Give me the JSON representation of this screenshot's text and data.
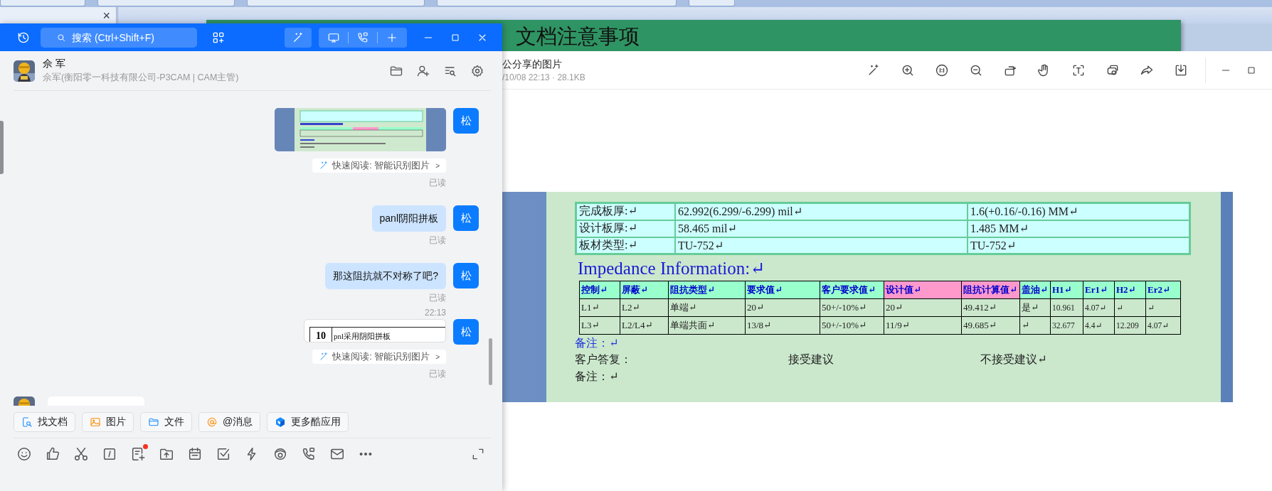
{
  "background": {
    "close_glyph": "×",
    "banner_title": "文档注意事项"
  },
  "chat": {
    "search": {
      "placeholder": "搜索 (Ctrl+Shift+F)"
    },
    "contact": {
      "name": "佘 军",
      "subtitle": "佘军(衡阳零一科技有限公司-P3CAM | CAM主管)"
    },
    "messages": [
      {
        "kind": "image",
        "avatar": "松",
        "quick_read": "快速阅读: 智能识别图片",
        "quick_read_chevron": ">",
        "status": "已读"
      },
      {
        "kind": "text",
        "avatar": "松",
        "text": "panl阴阳拼板",
        "status": "已读"
      },
      {
        "kind": "text",
        "avatar": "松",
        "text": "那这阻抗就不对称了吧?",
        "status": "已读"
      },
      {
        "kind": "time",
        "text": "22:13"
      },
      {
        "kind": "doc_image",
        "avatar": "松",
        "cells": [
          "10",
          "pnl采用阴阳拼板"
        ],
        "quick_read": "快速阅读: 智能识别图片",
        "quick_read_chevron": ">",
        "status": "已读"
      },
      {
        "kind": "incoming"
      }
    ],
    "quick_actions": [
      {
        "kind": "docs",
        "label": "找文档"
      },
      {
        "kind": "image",
        "label": "图片"
      },
      {
        "kind": "file",
        "label": "文件"
      },
      {
        "kind": "mention",
        "label": "@消息"
      },
      {
        "kind": "apps",
        "label": "更多酷应用"
      }
    ],
    "composer": {
      "note_badge": true
    }
  },
  "viewer": {
    "title": "公分享的图片",
    "meta": "/10/08 22:13 · 28.1KB",
    "document": {
      "info_rows": [
        [
          "完成板厚:↵",
          "62.992(6.299/-6.299) mil↵",
          "1.6(+0.16/-0.16) MM↵"
        ],
        [
          "设计板厚:↵",
          "58.465 mil↵",
          "1.485 MM↵"
        ],
        [
          "板材类型:↵",
          "TU-752↵",
          "TU-752↵"
        ]
      ],
      "impedance_title": "Impedance Information:↵",
      "columns": [
        {
          "label": "控制↵",
          "color": "#99ffcc"
        },
        {
          "label": "屏蔽↵",
          "color": "#99ffcc"
        },
        {
          "label": "阻抗类型↵",
          "color": "#99ffcc"
        },
        {
          "label": "要求值↵",
          "color": "#99ffcc"
        },
        {
          "label": "客户要求值↵",
          "color": "#99ffcc"
        },
        {
          "label": "设计值↵",
          "color": "#ff99cc"
        },
        {
          "label": "阻抗计算值↵",
          "color": "#ff99cc"
        },
        {
          "label": "盖油↵",
          "color": "#99ffcc"
        },
        {
          "label": "H1↵",
          "color": "#99ffcc"
        },
        {
          "label": "Er1↵",
          "color": "#99ffcc"
        },
        {
          "label": "H2↵",
          "color": "#99ffcc"
        },
        {
          "label": "Er2↵",
          "color": "#99ffcc"
        }
      ],
      "rows": [
        [
          "L1↵",
          "L2↵",
          "单端↵",
          "20↵",
          "50+/-10%↵",
          "20↵",
          "49.412↵",
          "是↵",
          "10.961",
          "4.07↵",
          "↵",
          "↵"
        ],
        [
          "L3↵",
          "L2/L4↵",
          "单端共面↵",
          "13/8↵",
          "50+/-10%↵",
          "11/9↵",
          "49.685↵",
          "↵",
          "32.677",
          "4.4↵",
          "12.209",
          "4.07↵"
        ]
      ],
      "note": "备注：↵",
      "reply": {
        "label": "客户答复：",
        "accept": "接受建议",
        "reject": "不接受建议↵"
      },
      "final_note": "备注：↵"
    }
  }
}
